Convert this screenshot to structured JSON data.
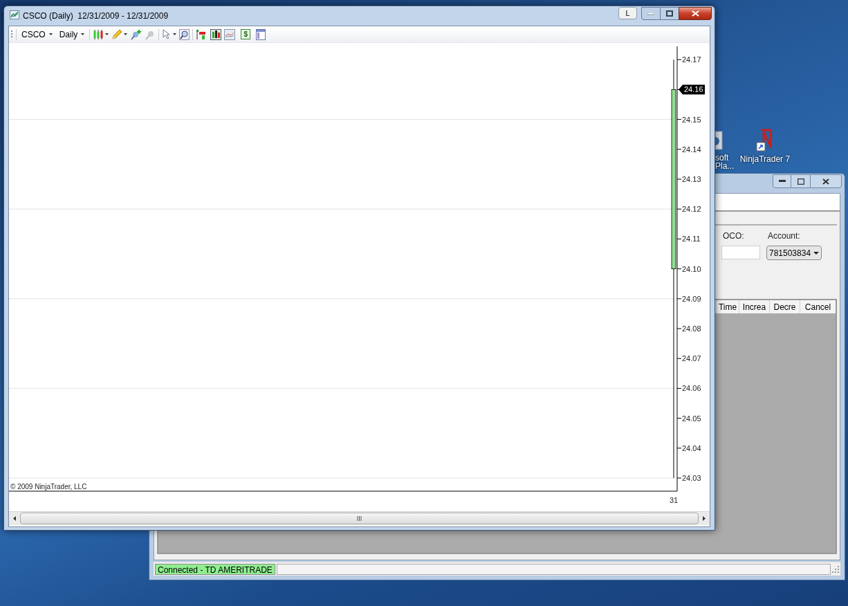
{
  "desktop_icons": [
    {
      "kind": "partial",
      "label_lines": [
        "soft",
        "Pla..."
      ]
    },
    {
      "kind": "app",
      "label_lines": [
        "NinjaTrader 7"
      ]
    }
  ],
  "back_window": {
    "account_label": "Account:",
    "account_value": "781503834",
    "oco_label": "OCO:",
    "table_columns": [
      "Time",
      "Increa",
      "Decre",
      "Cancel"
    ],
    "status_bar": {
      "connection": "Connected - TD AMERITRADE",
      "connected": true
    }
  },
  "chart_window": {
    "title": "CSCO (Daily)  12/31/2009 - 12/31/2009",
    "link_button": "L",
    "toolbar": {
      "instrument": "CSCO",
      "period": "Daily",
      "data_box_glyph": "$"
    },
    "chart": {
      "copyright": "© 2009 NinjaTrader, LLC",
      "price_marker": "24.16",
      "date_label": "31",
      "price_axis_labels": [
        "24.17",
        "24.15",
        "24.14",
        "24.13",
        "24.12",
        "24.11",
        "24.10",
        "24.09",
        "24.08",
        "24.07",
        "24.06",
        "24.05",
        "24.04",
        "24.03"
      ]
    }
  }
}
